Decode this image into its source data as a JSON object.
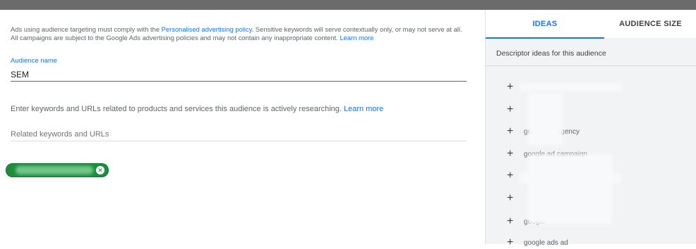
{
  "policy_notice": {
    "part1": "Ads using audience targeting must comply with the ",
    "policy_link": "Personalised advertising policy",
    "part2": ". Sensitive keywords will serve contextually only, or may not serve at all. All campaigns are subject to the Google Ads advertising policies and may not contain any inappropriate content. ",
    "learn_more": "Learn more"
  },
  "audience_name": {
    "label": "Audience name",
    "value": "SEM"
  },
  "keywords_section": {
    "instruction": "Enter keywords and URLs related to products and services this audience is actively researching. ",
    "learn_more": "Learn more",
    "placeholder": "Related keywords and URLs"
  },
  "chip": {
    "close_symbol": "✕"
  },
  "right_panel": {
    "tabs": {
      "ideas": "IDEAS",
      "audience_size": "AUDIENCE SIZE"
    },
    "descriptor_title": "Descriptor ideas for this audience",
    "ideas": [
      {
        "icon": "+",
        "text": ""
      },
      {
        "icon": "+",
        "text": ""
      },
      {
        "icon": "+",
        "text": "google ad agency"
      },
      {
        "icon": "+",
        "text": "google ad campaign"
      },
      {
        "icon": "+",
        "text": ""
      },
      {
        "icon": "+",
        "text": ""
      },
      {
        "icon": "+",
        "text": "google"
      },
      {
        "icon": "+",
        "text": "google ads ad"
      }
    ]
  },
  "colors": {
    "accent": "#1a73e8",
    "chip_green": "#1e8e3e",
    "top_bar": "#6b6b6b"
  }
}
